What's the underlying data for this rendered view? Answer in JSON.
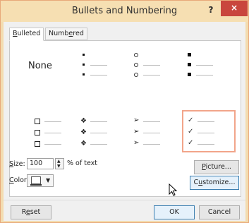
{
  "window": {
    "title": "Bullets and Numbering",
    "help_label": "?",
    "close_label": "×"
  },
  "tabs": [
    {
      "label_first": "B",
      "label_rest": "ulleted",
      "active": true
    },
    {
      "label_first": "Numb",
      "label_u": "e",
      "label_rest": "red",
      "active": false
    }
  ],
  "bullet_gallery": {
    "none_label": "None",
    "styles": [
      "none",
      "small-dot",
      "hollow-circle",
      "filled-square",
      "hollow-box",
      "four-diamond",
      "arrowhead",
      "check-mark"
    ],
    "selected": "check-mark",
    "glyphs": {
      "four_diamond": "❖",
      "arrowhead": "➢",
      "check_mark": "✓"
    }
  },
  "size": {
    "label_u": "S",
    "label_rest": "ize:",
    "value": "100",
    "unit_label": "% of text"
  },
  "color": {
    "label_u": "C",
    "label_rest": "olor",
    "selected": "#000000",
    "dropdown_arrow": "▼"
  },
  "buttons": {
    "picture_u": "P",
    "picture_rest": "icture...",
    "customize_pre": "C",
    "customize_u": "u",
    "customize_rest": "stomize...",
    "reset_pre": "R",
    "reset_u": "e",
    "reset_rest": "set",
    "ok": "OK",
    "cancel": "Cancel"
  },
  "colors": {
    "title_bar": "#f6dfb2",
    "close_button": "#c9463d",
    "selection_border": "#f2a58a"
  }
}
